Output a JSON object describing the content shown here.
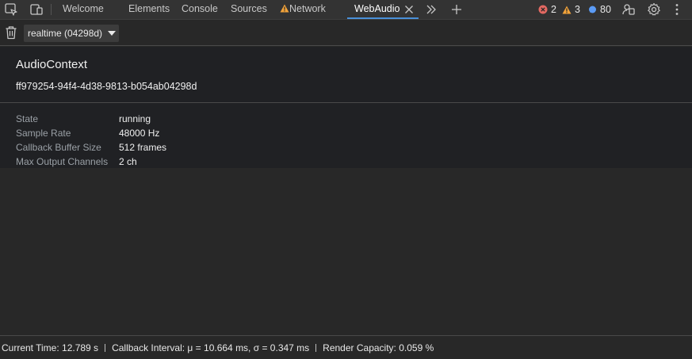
{
  "tabs": [
    {
      "label": "Welcome"
    },
    {
      "label": "Elements"
    },
    {
      "label": "Console"
    },
    {
      "label": "Sources"
    },
    {
      "label": "Network"
    },
    {
      "label": "WebAudio",
      "active": true
    }
  ],
  "counters": {
    "errors": "2",
    "warnings": "3",
    "messages": "80"
  },
  "icons": {
    "inspect": "inspect-element-icon",
    "device": "device-toolbar-icon",
    "network_warning": "warning-icon",
    "close_tab": "close-icon",
    "more_tabs": "chevron-double-right-icon",
    "add_tab": "plus-icon",
    "error": "error-icon",
    "warning": "warning-icon",
    "message": "message-icon",
    "customize": "customize-icon",
    "settings": "gear-icon",
    "menu": "kebab-menu-icon",
    "clear": "trash-icon"
  },
  "colors": {
    "error": "#e46962",
    "warning": "#f2a33a",
    "message": "#5b9bf5",
    "active_tab_underline": "#4a90d9"
  },
  "toolbar": {
    "context_select": "realtime (04298d)"
  },
  "context": {
    "title": "AudioContext",
    "id": "ff979254-94f4-4d38-9813-b054ab04298d",
    "properties": [
      {
        "key": "State",
        "value": "running"
      },
      {
        "key": "Sample Rate",
        "value": "48000 Hz"
      },
      {
        "key": "Callback Buffer Size",
        "value": "512 frames"
      },
      {
        "key": "Max Output Channels",
        "value": "2 ch"
      }
    ]
  },
  "status": {
    "current_time": "Current Time: 12.789 s",
    "callback_interval": "Callback Interval: μ = 10.664 ms, σ = 0.347 ms",
    "render_capacity": "Render Capacity: 0.059 %"
  }
}
